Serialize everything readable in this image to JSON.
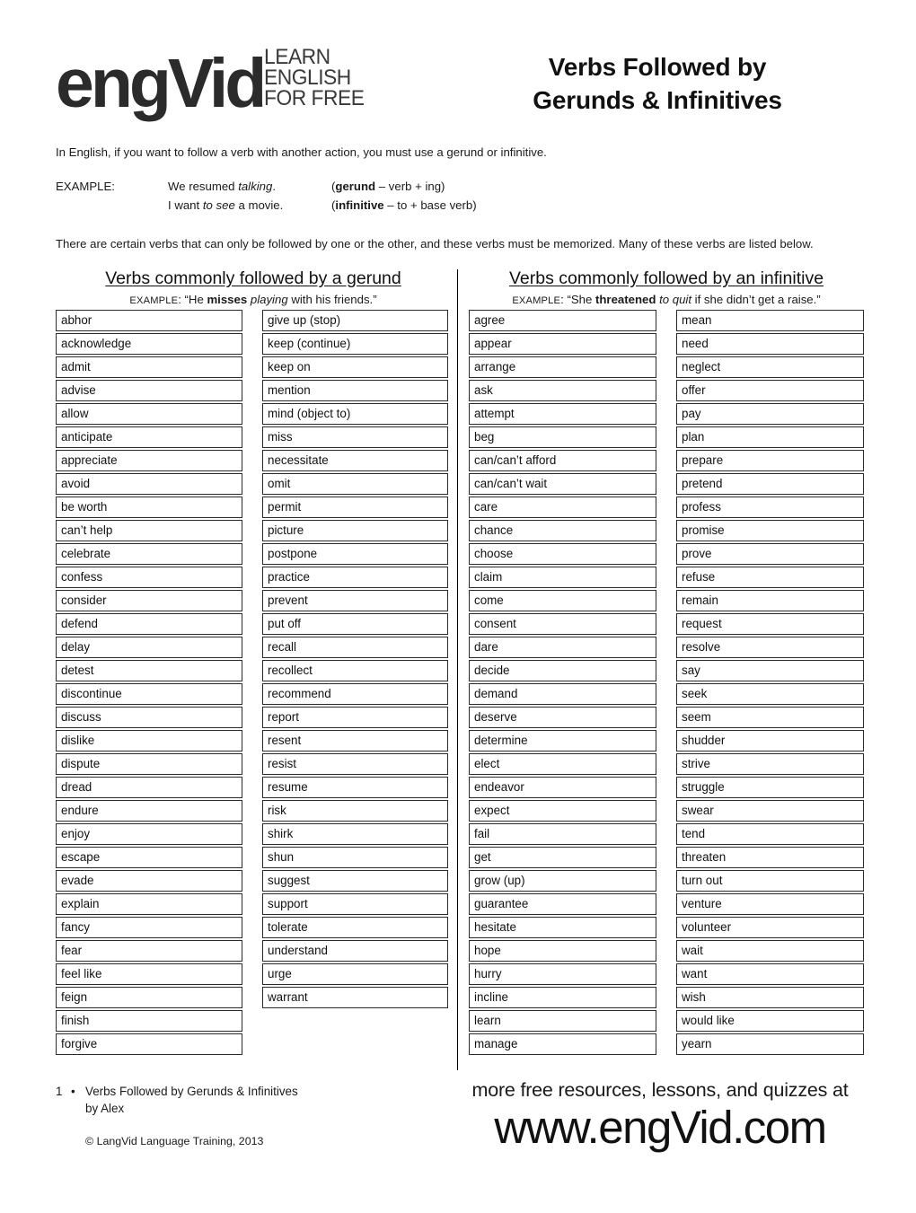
{
  "brand": {
    "logo_word": "engVid",
    "logo_tagline": [
      "LEARN",
      "ENGLISH",
      "FOR FREE"
    ]
  },
  "header": {
    "title_line1": "Verbs Followed by",
    "title_line2": "Gerunds & Infinitives"
  },
  "intro": {
    "paragraph1": "In English, if you want to follow a verb with another action, you must use a gerund or infinitive.",
    "example_label": "EXAMPLE:",
    "example_rows": [
      {
        "sentence_pre": "We resumed ",
        "sentence_em": "talking",
        "sentence_post": ".",
        "note_open": "(",
        "note_bold": "gerund",
        "note_rest": " – verb + ing)"
      },
      {
        "sentence_pre": "I want ",
        "sentence_em": "to see",
        "sentence_post": " a movie.",
        "note_open": "(",
        "note_bold": "infinitive",
        "note_rest": " – to + base verb)"
      }
    ],
    "paragraph2": "There are certain verbs that can only be followed by one or the other, and these verbs must be memorized. Many of these verbs are listed below."
  },
  "sections": [
    {
      "id": "gerund",
      "title": "Verbs commonly followed by a gerund",
      "example_label": "EXAMPLE",
      "example_pre": ": “He ",
      "example_bold": "misses",
      "example_mid": " ",
      "example_em": "playing",
      "example_post": " with his friends.”",
      "columns": [
        [
          "abhor",
          "acknowledge",
          "admit",
          "advise",
          "allow",
          "anticipate",
          "appreciate",
          "avoid",
          "be worth",
          "can’t help",
          "celebrate",
          "confess",
          "consider",
          "defend",
          "delay",
          "detest",
          "discontinue",
          "discuss",
          "dislike",
          "dispute",
          "dread",
          "endure",
          "enjoy",
          "escape",
          "evade",
          "explain",
          "fancy",
          "fear",
          "feel like",
          "feign",
          "finish",
          "forgive"
        ],
        [
          "give up (stop)",
          "keep (continue)",
          "keep on",
          "mention",
          "mind (object to)",
          "miss",
          "necessitate",
          "omit",
          "permit",
          "picture",
          "postpone",
          "practice",
          "prevent",
          "put off",
          "recall",
          "recollect",
          "recommend",
          "report",
          "resent",
          "resist",
          "resume",
          "risk",
          "shirk",
          "shun",
          "suggest",
          "support",
          "tolerate",
          "understand",
          "urge",
          "warrant"
        ]
      ]
    },
    {
      "id": "infinitive",
      "title": "Verbs commonly followed by an infinitive",
      "example_label": "EXAMPLE",
      "example_pre": ": “She ",
      "example_bold": "threatened",
      "example_mid": " ",
      "example_em": "to quit",
      "example_post": " if she didn’t get a raise.”",
      "columns": [
        [
          "agree",
          "appear",
          "arrange",
          "ask",
          "attempt",
          "beg",
          "can/can’t afford",
          "can/can’t wait",
          "care",
          "chance",
          "choose",
          "claim",
          "come",
          "consent",
          "dare",
          "decide",
          "demand",
          "deserve",
          "determine",
          "elect",
          "endeavor",
          "expect",
          "fail",
          "get",
          "grow (up)",
          "guarantee",
          "hesitate",
          "hope",
          "hurry",
          "incline",
          "learn",
          "manage"
        ],
        [
          "mean",
          "need",
          "neglect",
          "offer",
          "pay",
          "plan",
          "prepare",
          "pretend",
          "profess",
          "promise",
          "prove",
          "refuse",
          "remain",
          "request",
          "resolve",
          "say",
          "seek",
          "seem",
          "shudder",
          "strive",
          "struggle",
          "swear",
          "tend",
          "threaten",
          "turn out",
          "venture",
          "volunteer",
          "wait",
          "want",
          "wish",
          "would like",
          "yearn"
        ]
      ]
    }
  ],
  "footer": {
    "page_number": "1",
    "bullet": "•",
    "doc_title": "Verbs Followed by Gerunds & Infinitives",
    "author": "by Alex",
    "copyright": "© LangVid Language Training, 2013",
    "promo_line1": "more free resources, lessons, and quizzes at",
    "promo_line2": "www.engVid.com"
  }
}
